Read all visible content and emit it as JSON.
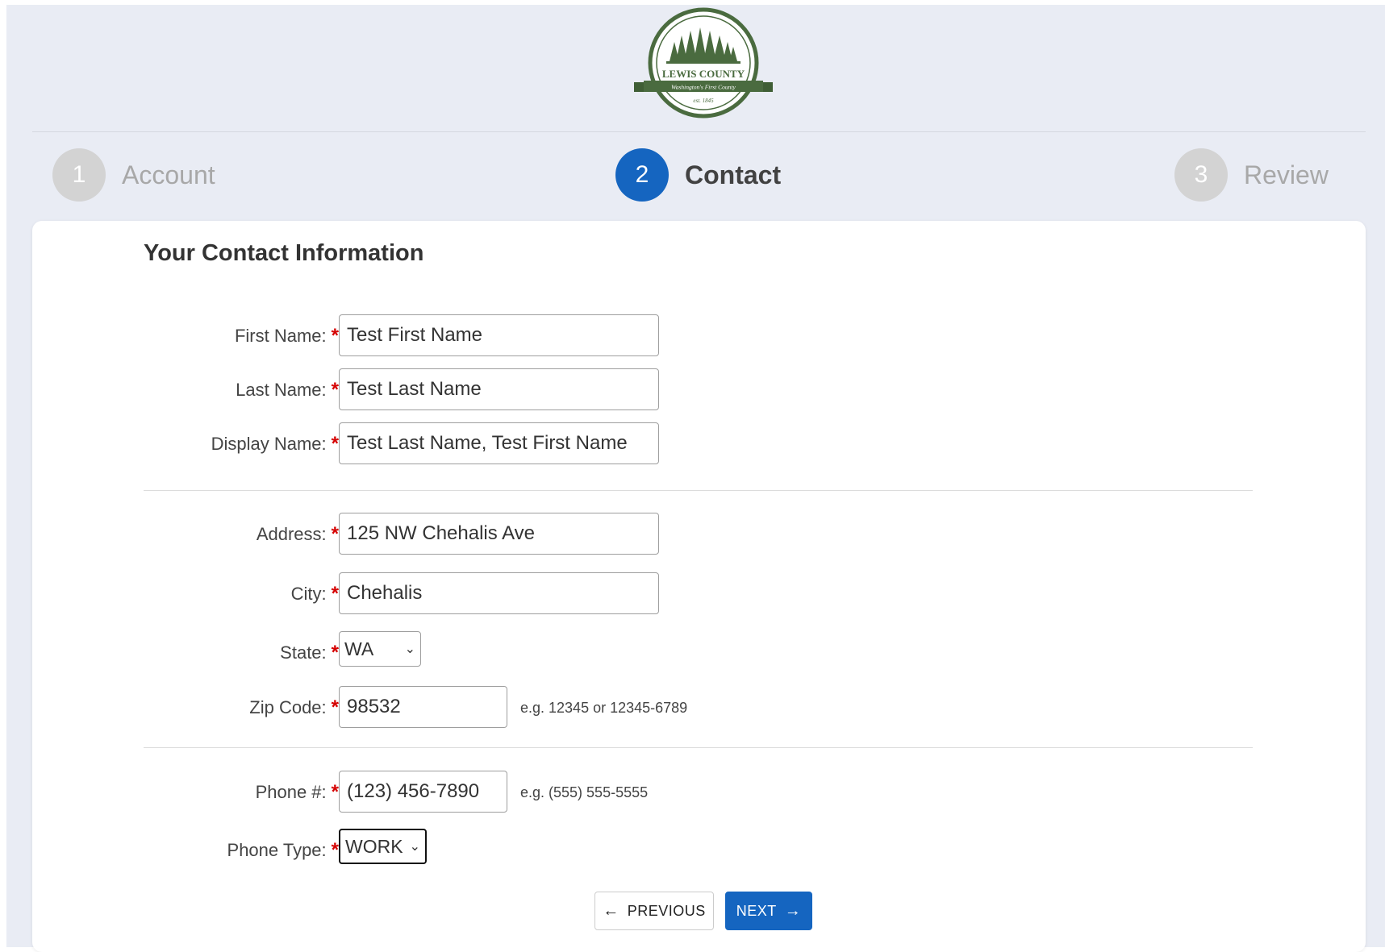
{
  "branding": {
    "logo_name": "LEWIS COUNTY",
    "logo_tagline": "Washington's First County",
    "logo_est": "est. 1845"
  },
  "stepper": {
    "steps": [
      {
        "number": "1",
        "label": "Account",
        "state": "done"
      },
      {
        "number": "2",
        "label": "Contact",
        "state": "active"
      },
      {
        "number": "3",
        "label": "Review",
        "state": "upcoming"
      }
    ]
  },
  "form": {
    "title": "Your Contact Information",
    "required_mark": "*",
    "first_name": {
      "label": "First Name:",
      "value": "Test First Name"
    },
    "last_name": {
      "label": "Last Name:",
      "value": "Test Last Name"
    },
    "display_name": {
      "label": "Display Name:",
      "value": "Test Last Name, Test First Name"
    },
    "address": {
      "label": "Address:",
      "value": "125 NW Chehalis Ave"
    },
    "city": {
      "label": "City:",
      "value": "Chehalis"
    },
    "state": {
      "label": "State:",
      "value": "WA"
    },
    "zip": {
      "label": "Zip Code:",
      "value": "98532",
      "hint": "e.g. 12345 or 12345-6789"
    },
    "phone": {
      "label": "Phone #:",
      "value": "(123) 456-7890",
      "hint": "e.g. (555) 555-5555"
    },
    "phone_type": {
      "label": "Phone Type:",
      "value": "WORK"
    }
  },
  "buttons": {
    "previous_label": "PREVIOUS",
    "next_label": "NEXT"
  },
  "colors": {
    "accent": "#1565c0",
    "required": "#d50000",
    "background": "#e9ecf4",
    "logo_green": "#4a6b3f"
  }
}
